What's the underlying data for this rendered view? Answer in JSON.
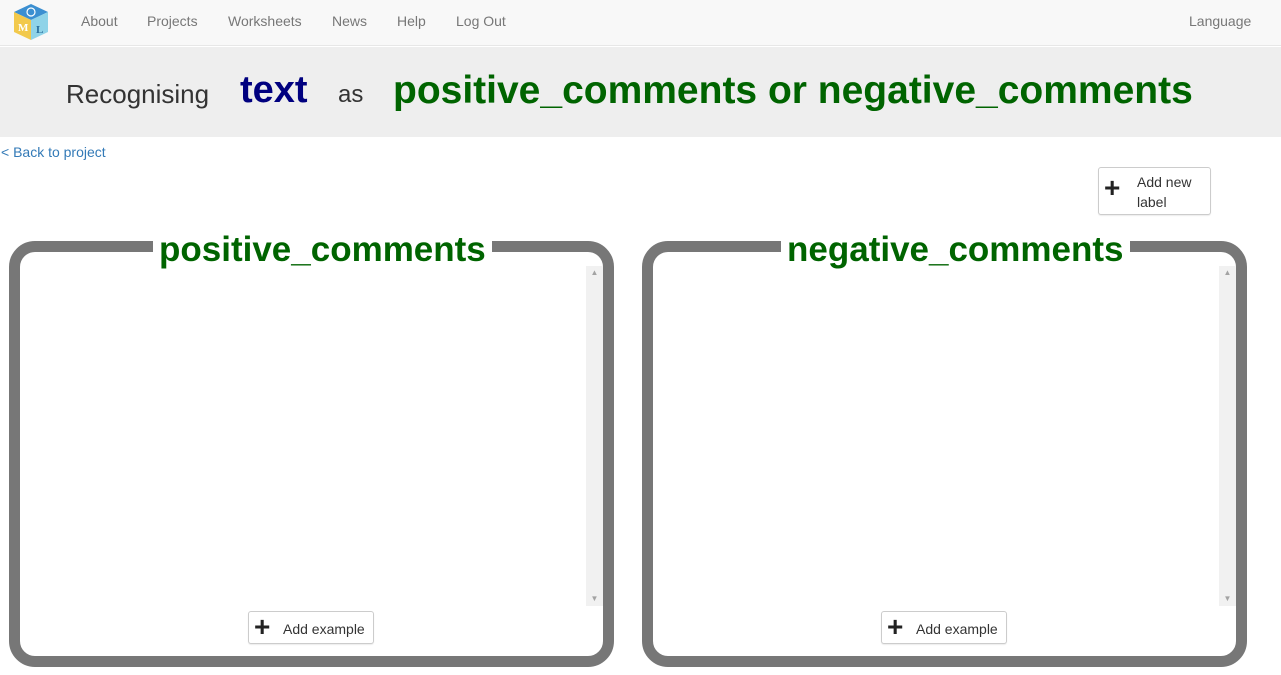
{
  "nav": {
    "links": [
      "About",
      "Projects",
      "Worksheets",
      "News",
      "Help",
      "Log Out"
    ],
    "language": "Language",
    "logo_icon": "ml-blocks-logo-icon"
  },
  "banner": {
    "prefix": "Recognising",
    "type": "text",
    "joiner": "as",
    "labels": "positive_comments or negative_comments"
  },
  "back_link": "< Back to project",
  "add_label_button": {
    "line1": "Add new",
    "line2": "label",
    "icon": "plus-icon"
  },
  "buckets": [
    {
      "title": "positive_comments",
      "add_example_label": "Add example"
    },
    {
      "title": "negative_comments",
      "add_example_label": "Add example"
    }
  ],
  "colors": {
    "label_green": "#006400",
    "type_navy": "#00007f",
    "bucket_border": "#777777",
    "link_blue": "#337ab7"
  }
}
